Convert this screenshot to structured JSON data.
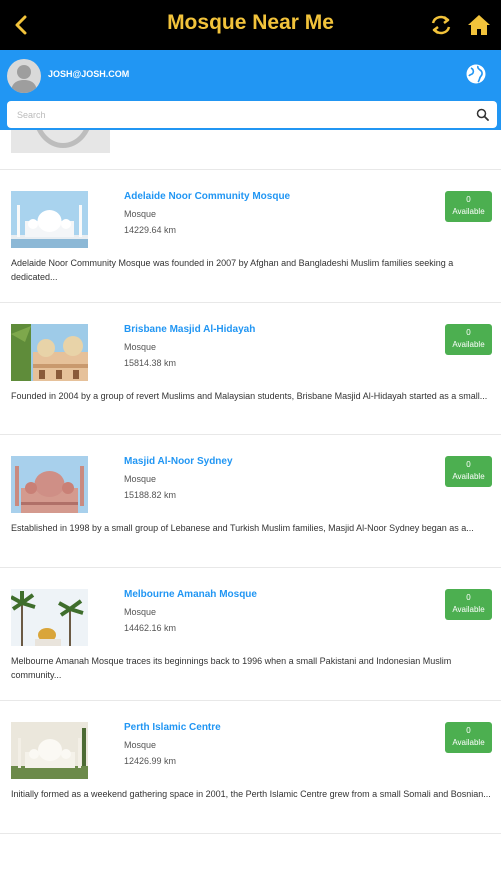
{
  "header": {
    "title": "Mosque Near Me"
  },
  "user": {
    "email": "JOSH@JOSH.COM"
  },
  "search": {
    "placeholder": "Search",
    "value": ""
  },
  "theme": {
    "accent": "#2196f3",
    "title_color": "#f2c33b",
    "badge_color": "#4caf50"
  },
  "icons": {
    "back": "back-arrow-icon",
    "refresh": "refresh-icon",
    "home": "home-icon",
    "globe": "globe-icon",
    "search": "search-icon"
  },
  "mosques": [
    {
      "name": "Adelaide Noor Community Mosque",
      "category": "Mosque",
      "distance": "14229.64 km",
      "count": "0",
      "status": "Available",
      "description": "Adelaide Noor Community Mosque was founded in 2007 by Afghan and Bangladeshi Muslim families seeking a dedicated..."
    },
    {
      "name": "Brisbane Masjid Al-Hidayah",
      "category": "Mosque",
      "distance": "15814.38 km",
      "count": "0",
      "status": "Available",
      "description": "Founded in 2004 by a group of revert Muslims and Malaysian students, Brisbane Masjid Al-Hidayah started as a small..."
    },
    {
      "name": "Masjid Al-Noor Sydney",
      "category": "Mosque",
      "distance": "15188.82 km",
      "count": "0",
      "status": "Available",
      "description": "Established in 1998 by a small group of Lebanese and Turkish Muslim families, Masjid Al-Noor Sydney began as a..."
    },
    {
      "name": "Melbourne Amanah Mosque",
      "category": "Mosque",
      "distance": "14462.16 km",
      "count": "0",
      "status": "Available",
      "description": "Melbourne Amanah Mosque traces its beginnings back to 1996 when a small Pakistani and Indonesian Muslim community..."
    },
    {
      "name": "Perth Islamic Centre",
      "category": "Mosque",
      "distance": "12426.99 km",
      "count": "0",
      "status": "Available",
      "description": "Initially formed as a weekend gathering space in 2001, the Perth Islamic Centre grew from a small Somali and Bosnian..."
    }
  ]
}
